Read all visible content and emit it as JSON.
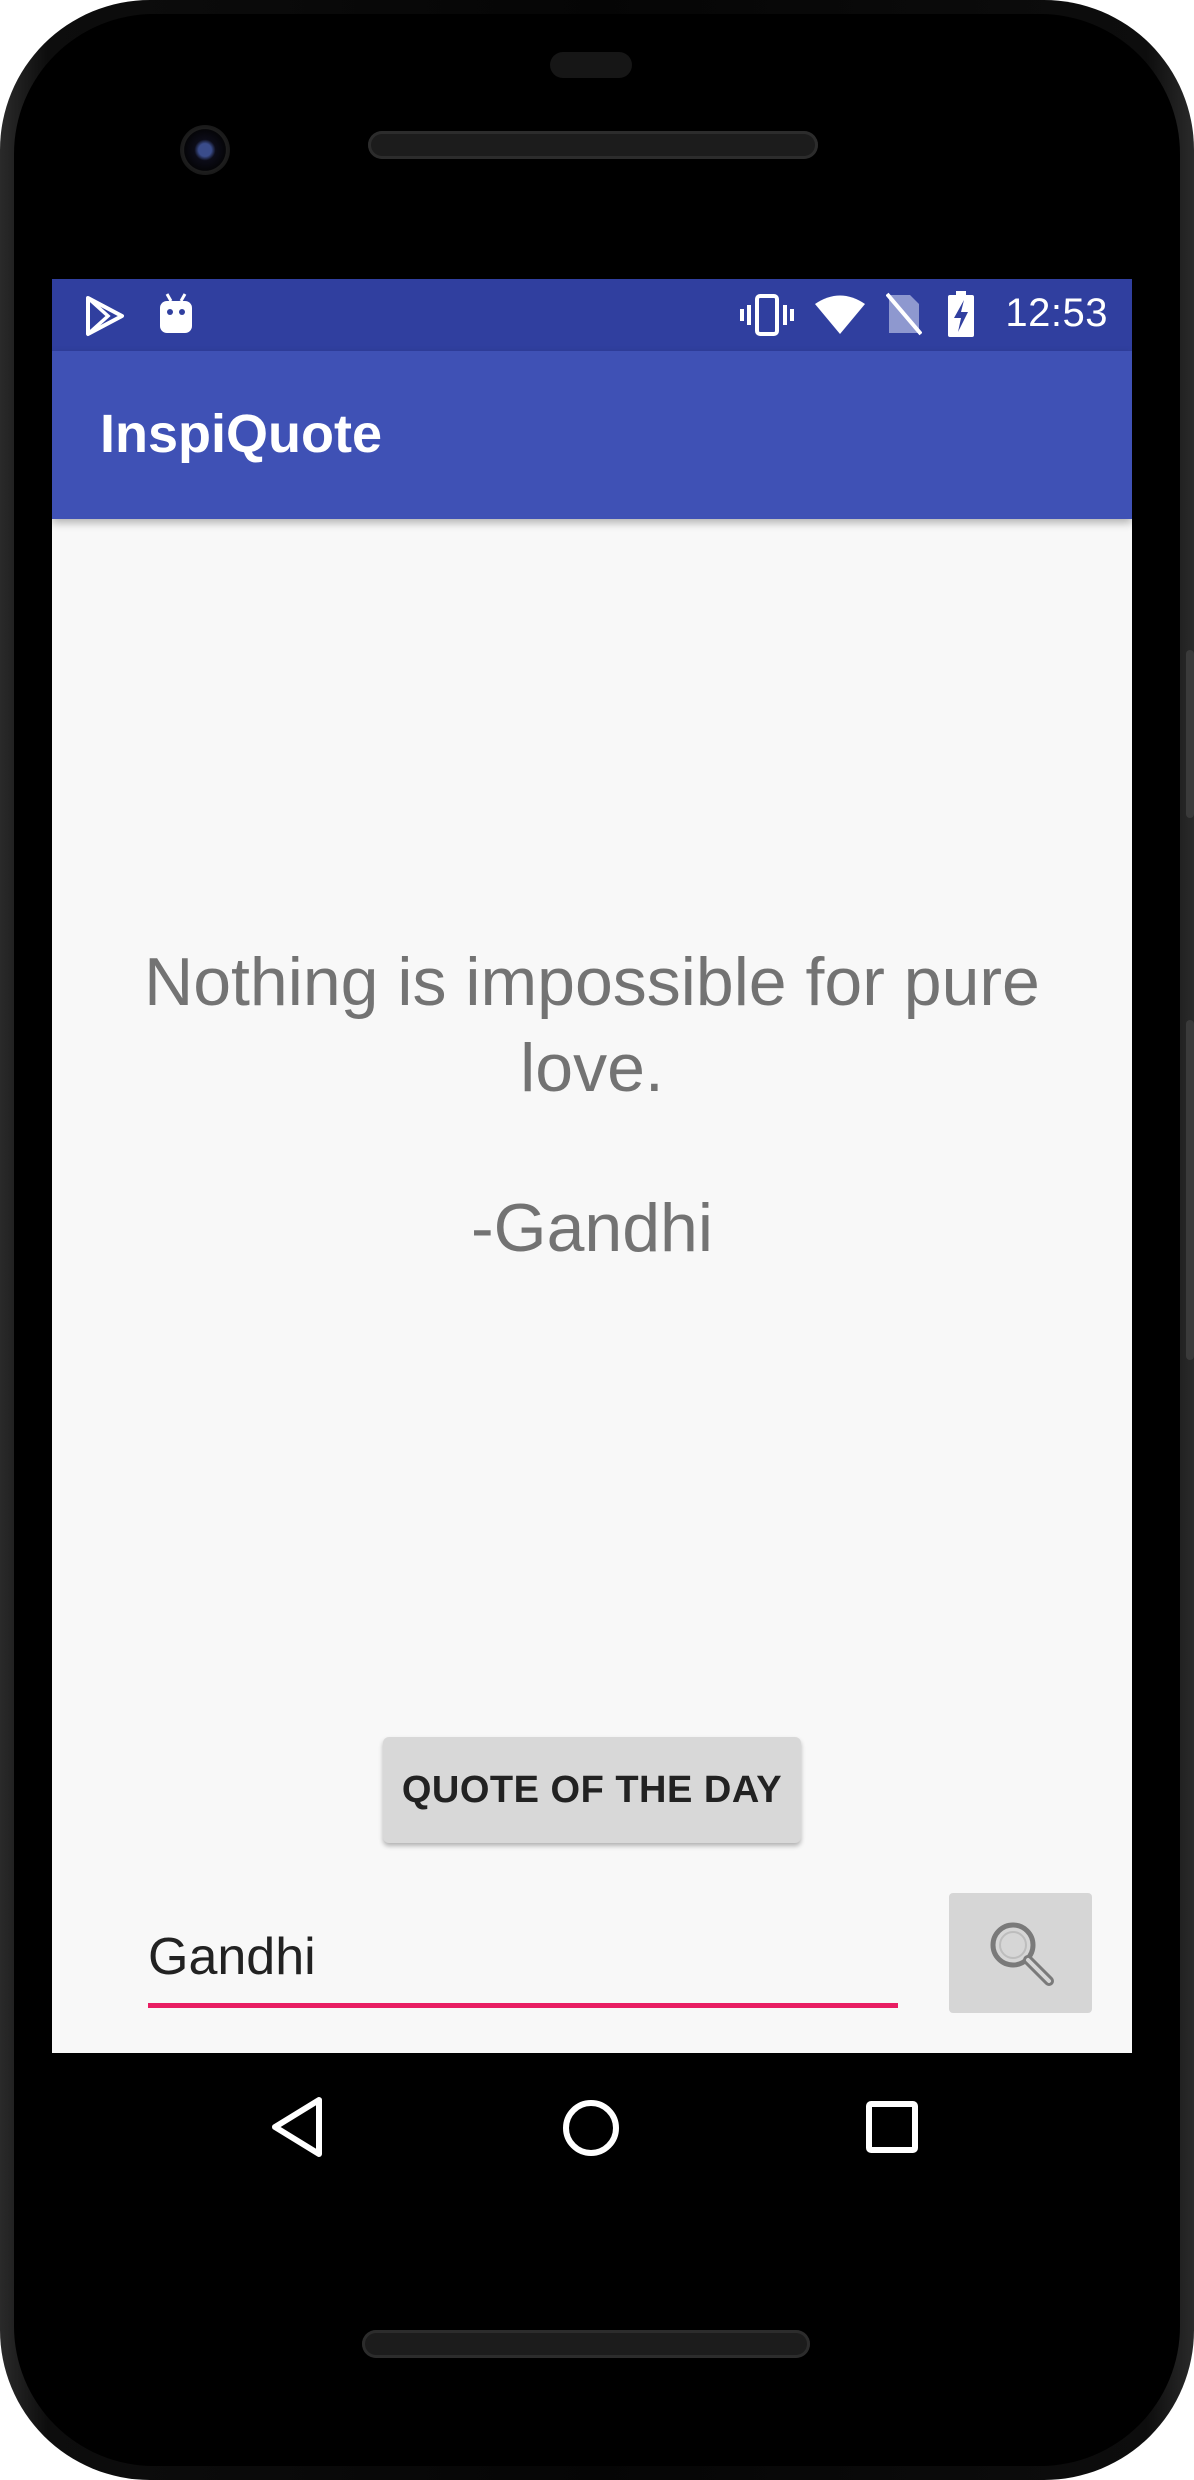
{
  "status_bar": {
    "time": "12:53",
    "left_icons": [
      "play-store-icon",
      "android-icon"
    ],
    "right_icons": [
      "vibrate-icon",
      "wifi-icon",
      "no-sim-icon",
      "battery-charging-icon"
    ]
  },
  "app_bar": {
    "title": "InspiQuote"
  },
  "quote": {
    "text": "Nothing is impossible for pure love.",
    "author": "-Gandhi"
  },
  "quote_of_day_button": {
    "label": "QUOTE OF THE DAY"
  },
  "search": {
    "value": "Gandhi",
    "button_icon": "search-icon"
  },
  "nav_bar": {
    "icons": [
      "back-icon",
      "home-icon",
      "recents-icon"
    ]
  },
  "colors": {
    "status_bar": "#303f9f",
    "app_bar": "#3f51b5",
    "input_underline": "#e91e63",
    "background": "#f8f8f8",
    "quote_text": "#737373"
  }
}
